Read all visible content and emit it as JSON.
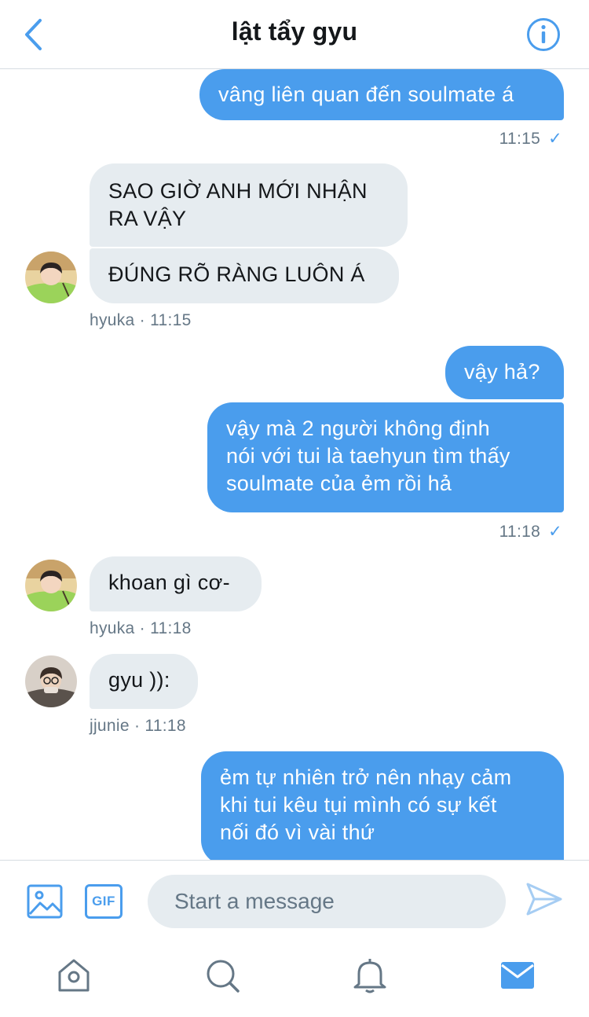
{
  "header": {
    "title": "lật tẩy gyu"
  },
  "messages": {
    "m1": {
      "text": "vâng liên quan đến soulmate á",
      "time": "11:15"
    },
    "m2": {
      "text": "SAO GIỜ ANH MỚI NHẬN\nRA VẬY"
    },
    "m3": {
      "text": "ĐÚNG RÕ RÀNG LUÔN Á",
      "meta": "hyuka · 11:15"
    },
    "m4": {
      "text": "vậy hả?"
    },
    "m5": {
      "text": "vậy mà 2 người không định\nnói với tui là taehyun tìm thấy\nsoulmate của ẻm rồi hả",
      "time": "11:18"
    },
    "m6": {
      "text": "khoan gì cơ-",
      "meta": "hyuka · 11:18"
    },
    "m7": {
      "text": "gyu )):",
      "meta": "jjunie · 11:18"
    },
    "m8": {
      "text": "ẻm tự nhiên trở nên nhạy cảm\nkhi tui kêu tụi mình có sự kết\nnối đó vì vài thứ"
    }
  },
  "composer": {
    "placeholder": "Start a message",
    "gif_label": "GIF"
  },
  "colors": {
    "accent": "#4a9ded",
    "incoming_bubble": "#e6ecf0",
    "meta_text": "#657786"
  }
}
